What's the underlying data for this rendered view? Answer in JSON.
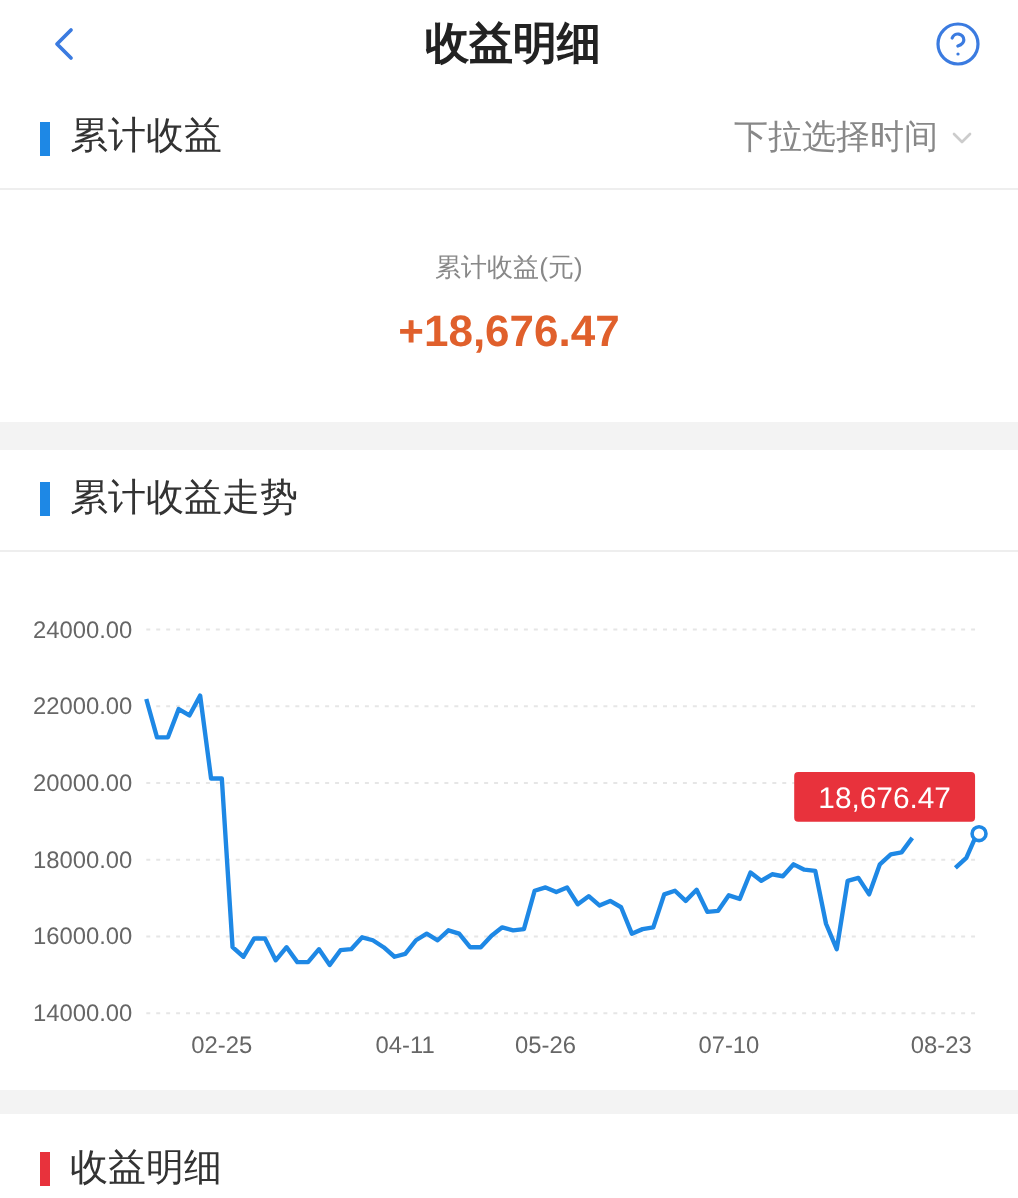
{
  "header": {
    "title": "收益明细"
  },
  "summary_section": {
    "title": "累计收益",
    "time_filter": "下拉选择时间",
    "label": "累计收益(元)",
    "total": "+18,676.47"
  },
  "trend_section": {
    "title": "累计收益走势",
    "chart_data": {
      "type": "line",
      "categories": [
        null,
        null,
        null,
        null,
        null,
        null,
        null,
        "02-25",
        null,
        null,
        null,
        null,
        null,
        null,
        null,
        null,
        null,
        null,
        null,
        null,
        null,
        null,
        null,
        null,
        "04-11",
        null,
        null,
        null,
        null,
        null,
        null,
        null,
        null,
        null,
        null,
        null,
        null,
        "05-26",
        null,
        null,
        null,
        null,
        null,
        null,
        null,
        null,
        null,
        null,
        null,
        null,
        null,
        null,
        null,
        null,
        "07-10",
        null,
        null,
        null,
        null,
        null,
        null,
        null,
        null,
        null,
        null,
        null,
        null,
        null,
        null,
        null,
        null,
        null,
        null,
        null,
        "08-23",
        null,
        null,
        null
      ],
      "series": [
        {
          "color": "#1e88e5",
          "values": [
            22190,
            21190,
            21190,
            21930,
            21760,
            22280,
            20120,
            20120,
            15720,
            15470,
            15950,
            15950,
            15380,
            15720,
            15330,
            15330,
            15670,
            15260,
            15640,
            15670,
            15980,
            15900,
            15720,
            15470,
            15550,
            15900,
            16070,
            15900,
            16160,
            16070,
            15720,
            15720,
            16020,
            16240,
            16160,
            16190,
            17190,
            17280,
            17160,
            17280,
            16840,
            17050,
            16810,
            16930,
            16760,
            16070,
            16190,
            16240,
            17100,
            17190,
            16930,
            17220,
            16640,
            16670,
            17070,
            16980,
            17670,
            17450,
            17620,
            17570,
            17880,
            17740,
            17710,
            16330,
            15670,
            17450,
            17530,
            17100,
            17880,
            18140,
            18190,
            18570,
            null,
            null,
            null,
            17790,
            18050,
            18680
          ]
        }
      ],
      "ylim": [
        14000,
        24000
      ],
      "yticks": [
        {
          "value": 14000,
          "label": "14000.00"
        },
        {
          "value": 16000,
          "label": "16000.00"
        },
        {
          "value": 18000,
          "label": "18000.00"
        },
        {
          "value": 20000,
          "label": "20000.00"
        },
        {
          "value": 22000,
          "label": "22000.00"
        },
        {
          "value": 24000,
          "label": "24000.00"
        }
      ],
      "grid": true,
      "annotations": [
        "18,676.47"
      ]
    }
  },
  "detail_section": {
    "title": "收益明细"
  }
}
